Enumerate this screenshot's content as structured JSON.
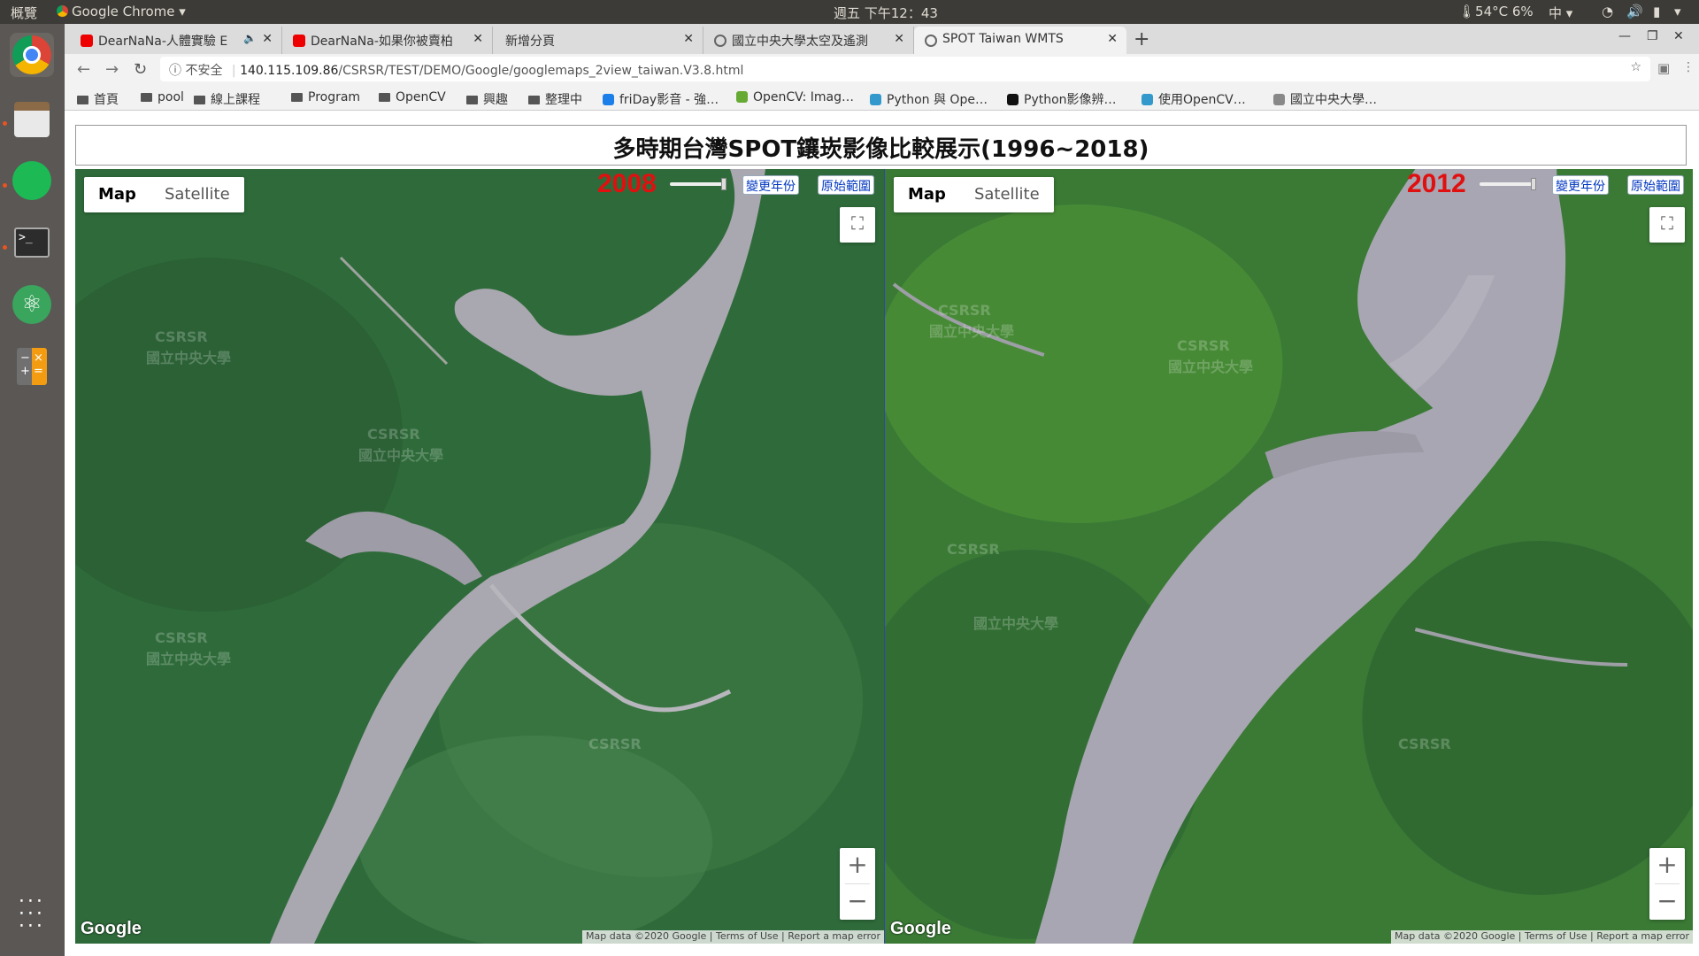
{
  "system": {
    "activities": "概覽",
    "app_name": "Google Chrome",
    "clock": "週五 下午12：43",
    "temperature": "54°C 6%",
    "input_method": "中"
  },
  "tabs": [
    {
      "title": "DearNaNa-人體實驗 E",
      "favicon": "youtube-icon",
      "active": false
    },
    {
      "title": "DearNaNa-如果你被賣柏",
      "favicon": "youtube-icon",
      "active": false
    },
    {
      "title": "新增分頁",
      "favicon": "",
      "active": false
    },
    {
      "title": "國立中央大學太空及遙測",
      "favicon": "globe-icon",
      "active": false
    },
    {
      "title": "SPOT Taiwan WMTS",
      "favicon": "globe-icon",
      "active": true
    }
  ],
  "address_bar": {
    "security": "不安全",
    "host": "140.115.109.86",
    "path": "/CSRSR/TEST/DEMO/Google/googlemaps_2view_taiwan.V3.8.html"
  },
  "bookmarks": [
    {
      "label": "首頁",
      "icon": "folder-icon"
    },
    {
      "label": "pool",
      "icon": "folder-icon"
    },
    {
      "label": "線上課程",
      "icon": "folder-icon"
    },
    {
      "label": "Program",
      "icon": "folder-icon"
    },
    {
      "label": "OpenCV",
      "icon": "folder-icon"
    },
    {
      "label": "興趣",
      "icon": "folder-icon"
    },
    {
      "label": "整理中",
      "icon": "folder-icon"
    },
    {
      "label": "friDay影音 - 強…",
      "icon": "friday-icon"
    },
    {
      "label": "OpenCV: Imag…",
      "icon": "opencv-icon"
    },
    {
      "label": "Python 與 Ope…",
      "icon": "page-icon"
    },
    {
      "label": "Python影像辨…",
      "icon": "medium-icon"
    },
    {
      "label": "使用OpenCV…",
      "icon": "page-icon"
    },
    {
      "label": "國立中央大學…",
      "icon": "globe-icon"
    }
  ],
  "page": {
    "title": "多時期台灣SPOT鑲崁影像比較展示(1996~2018)"
  },
  "maps": [
    {
      "year": "2008",
      "map_label": "Map",
      "satellite_label": "Satellite",
      "change_year_label": "變更年份",
      "reset_label": "原始範圍",
      "zoom_in": "+",
      "zoom_out": "−",
      "logo": "Google",
      "attribution": "Map data ©2020 Google",
      "terms": "Terms of Use",
      "report": "Report a map error",
      "watermark": "CSRSR",
      "watermark_cn": "國立中央大學"
    },
    {
      "year": "2012",
      "map_label": "Map",
      "satellite_label": "Satellite",
      "change_year_label": "變更年份",
      "reset_label": "原始範圍",
      "zoom_in": "+",
      "zoom_out": "−",
      "logo": "Google",
      "attribution": "Map data ©2020 Google",
      "terms": "Terms of Use",
      "report": "Report a map error",
      "watermark": "CSRSR",
      "watermark_cn": "國立中央大學"
    }
  ]
}
